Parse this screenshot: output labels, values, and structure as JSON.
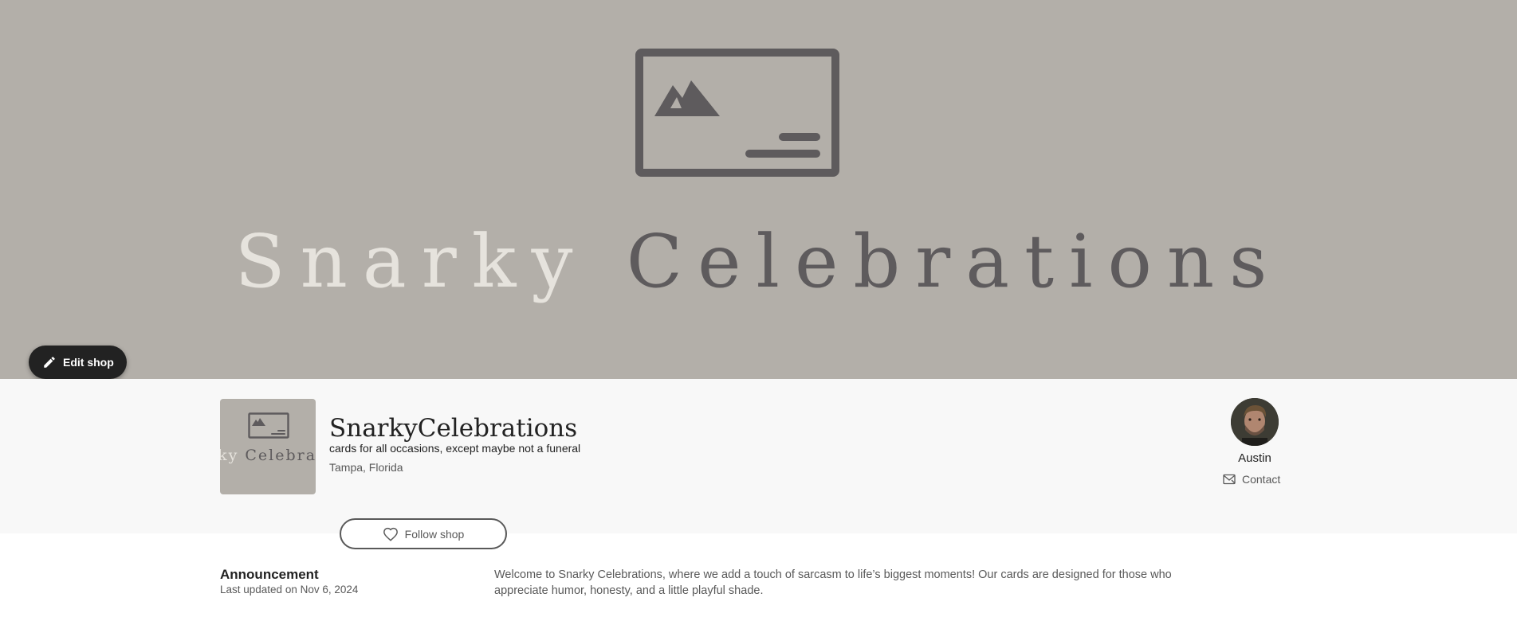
{
  "banner": {
    "title_word1": "Snarky",
    "title_word2": "Celebrations",
    "edit_label": "Edit shop",
    "icon": "image-placeholder-icon"
  },
  "shop": {
    "name": "SnarkyCelebrations",
    "tagline": "cards for all occasions, except maybe not a funeral",
    "location": "Tampa, Florida",
    "icon_text_word1": "rky",
    "icon_text_word2": "Celebrat",
    "follow_label": "Follow shop"
  },
  "owner": {
    "name": "Austin",
    "contact_label": "Contact"
  },
  "announcement": {
    "title": "Announcement",
    "updated": "Last updated on Nov 6, 2024",
    "text": "Welcome to Snarky Celebrations, where we add a touch of sarcasm to life’s biggest moments! Our cards are designed for those who appreciate humor, honesty, and a little playful shade."
  },
  "colors": {
    "banner_bg": "#b3afa9",
    "logo_dark": "#5e5b5d",
    "logo_light": "#e6e3dd",
    "edit_button_bg": "#222222"
  }
}
